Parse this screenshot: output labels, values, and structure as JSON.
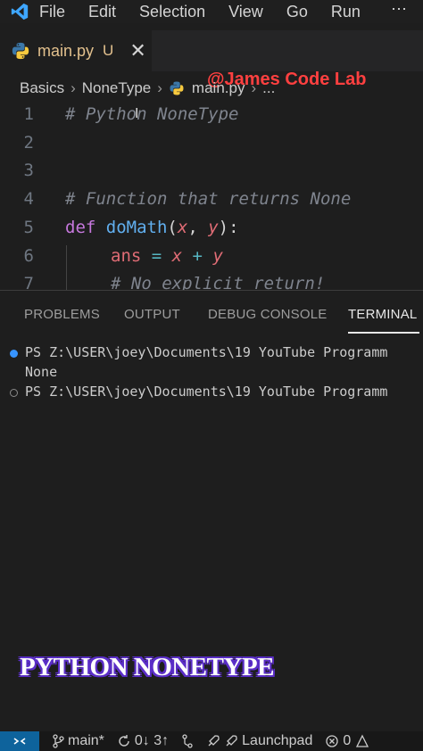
{
  "menubar": {
    "items": [
      "File",
      "Edit",
      "Selection",
      "View",
      "Go",
      "Run"
    ],
    "more_label": "⋯"
  },
  "tab": {
    "file_name": "main.py",
    "status": "U",
    "close_label": "✕"
  },
  "watermark": "@James Code Lab",
  "breadcrumb": {
    "items": [
      "Basics",
      "NoneType",
      "main.py",
      "..."
    ],
    "separator": "›"
  },
  "editor": {
    "line_numbers": [
      "1",
      "2",
      "3",
      "4",
      "5",
      "6",
      "7"
    ],
    "line1": "# Python NoneType",
    "line4": "# Function that returns None",
    "line5": {
      "kw": "def",
      "fn": "doMath",
      "open": "(",
      "p1": "x",
      "comma": ", ",
      "p2": "y",
      "close": "):"
    },
    "line6": {
      "lhs": "ans",
      "eq": " = ",
      "a": "x",
      "plus": " + ",
      "b": "y"
    },
    "line7": "# No explicit return!"
  },
  "panel": {
    "tabs": [
      "PROBLEMS",
      "OUTPUT",
      "DEBUG CONSOLE",
      "TERMINAL"
    ],
    "active_tab": "TERMINAL",
    "terminal_lines": [
      "PS Z:\\USER\\joey\\Documents\\19 YouTube Programm",
      "None",
      "PS Z:\\USER\\joey\\Documents\\19 YouTube Programm"
    ]
  },
  "overlay_title": "PYTHON NONETYPE",
  "statusbar": {
    "remote_icon": "⤫",
    "branch": "main*",
    "sync": "0↓ 3↑",
    "launchpad": "Launchpad",
    "errors": "0"
  },
  "colors": {
    "accent": "#0e639c",
    "watermark": "#ff4040",
    "modified": "#e2c08d",
    "title_outline": "#5b2ec8"
  }
}
